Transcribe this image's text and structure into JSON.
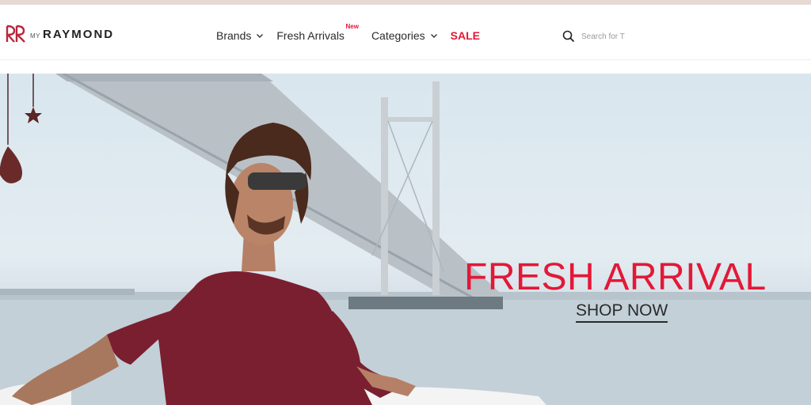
{
  "brand": {
    "prefix": "MY",
    "name": "RAYMOND"
  },
  "nav": {
    "items": [
      {
        "label": "Brands",
        "has_dropdown": true
      },
      {
        "label": "Fresh Arrivals",
        "badge": "New"
      },
      {
        "label": "Categories",
        "has_dropdown": true
      },
      {
        "label": "SALE"
      }
    ]
  },
  "search": {
    "placeholder": "Search for T",
    "icon": "search-icon"
  },
  "hero": {
    "headline": "FRESH ARRIVAL",
    "cta_label": "SHOP NOW"
  },
  "colors": {
    "accent": "#e31837",
    "text": "#2b2b2b",
    "maroon": "#7a1f30"
  }
}
